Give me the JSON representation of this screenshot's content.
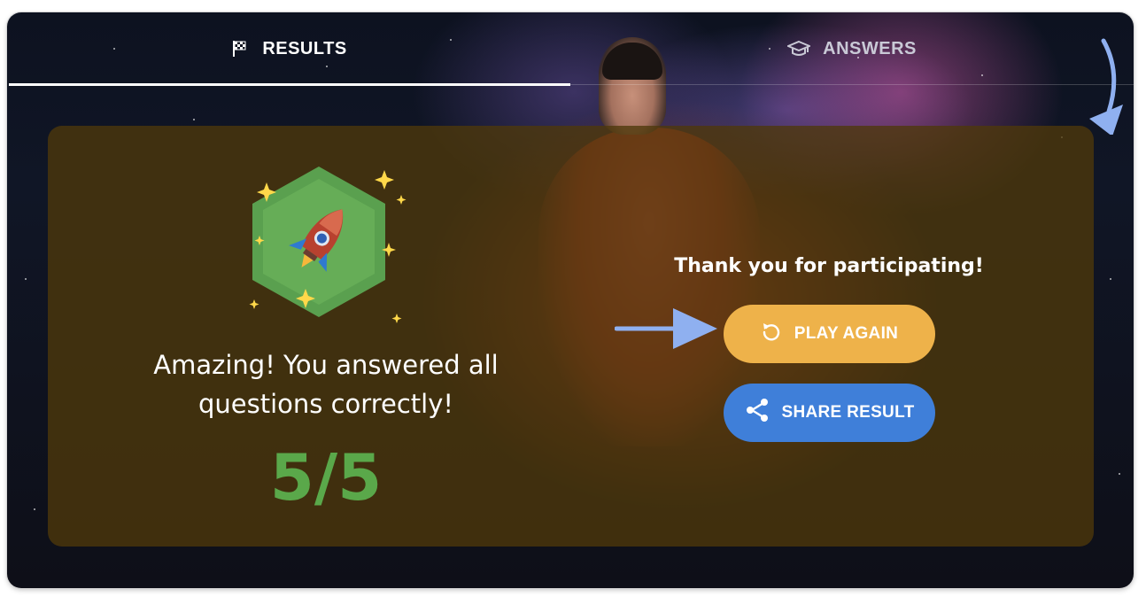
{
  "tabs": [
    {
      "label": "RESULTS",
      "icon": "checkered-flag-icon",
      "active": true
    },
    {
      "label": "ANSWERS",
      "icon": "graduation-cap-icon",
      "active": false
    }
  ],
  "result": {
    "message": "Amazing! You answered all questions correctly!",
    "score": "5/5",
    "badge_icon": "rocket-icon"
  },
  "actions": {
    "thanks": "Thank you for participating!",
    "play_again_label": "PLAY AGAIN",
    "play_again_icon": "replay-icon",
    "share_label": "SHARE RESULT",
    "share_icon": "share-icon"
  },
  "colors": {
    "score": "#5aa84a",
    "play_button": "#eeb24a",
    "share_button": "#3f7fd9",
    "overlay": "#4e380a",
    "badge": "#5aa04f",
    "annotation_arrow": "#8fb0f0"
  }
}
